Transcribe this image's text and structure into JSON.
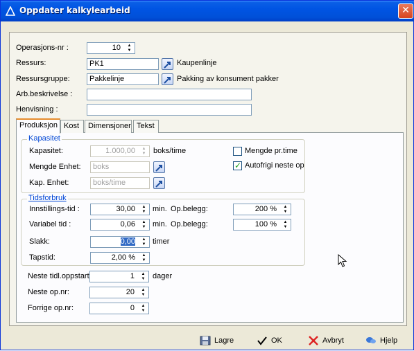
{
  "window": {
    "title": "Oppdater kalkylearbeid",
    "close_symbol": "✕"
  },
  "header_fields": {
    "operasjons_nr": {
      "label": "Operasjons-nr :",
      "value": "10"
    },
    "ressurs": {
      "label": "Ressurs:",
      "value": "PK1",
      "description": "Kaupenlinje"
    },
    "ressursgruppe": {
      "label": "Ressursgruppe:",
      "value": "Pakkelinje",
      "description": "Pakking av konsument pakker"
    },
    "arb_beskrivelse": {
      "label": "Arb.beskrivelse :",
      "value": ""
    },
    "henvisning": {
      "label": "Henvisning :",
      "value": ""
    }
  },
  "tabs": [
    {
      "label": "Produksjon",
      "active": true
    },
    {
      "label": "Kost",
      "active": false
    },
    {
      "label": "Dimensjoner",
      "active": false
    },
    {
      "label": "Tekst",
      "active": false
    }
  ],
  "kapasitet": {
    "group_title": "Kapasitet",
    "kapasitet": {
      "label": "Kapasitet:",
      "value": "1.000,00",
      "unit": "boks/time"
    },
    "mengde_enhet": {
      "label": "Mengde Enhet:",
      "value": "boks"
    },
    "kap_enhet": {
      "label": "Kap. Enhet:",
      "value": "boks/time"
    },
    "mengde_pr_time": {
      "label": "Mengde pr.time",
      "checked": false
    },
    "autofrigi": {
      "label": "Autofrigi neste op",
      "checked": true
    }
  },
  "tidsforbruk": {
    "group_title": "Tidsforbruk",
    "innstillings_tid": {
      "label": "Innstillings-tid :",
      "value": "30,00",
      "unit": "min.",
      "op_label": "Op.belegg:",
      "op_value": "200 %"
    },
    "variabel_tid": {
      "label": "Variabel tid :",
      "value": "0,06",
      "unit": "min.",
      "op_label": "Op.belegg:",
      "op_value": "100 %"
    },
    "slakk": {
      "label": "Slakk:",
      "value": "0,00",
      "unit": "timer"
    },
    "tapstid": {
      "label": "Tapstid:",
      "value": "2,00 %"
    }
  },
  "sequence": {
    "neste_tidl_oppstart": {
      "label": "Neste tidl.oppstart:",
      "value": "1",
      "unit": "dager"
    },
    "neste_op_nr": {
      "label": "Neste op.nr:",
      "value": "20"
    },
    "forrige_op_nr": {
      "label": "Forrige op.nr:",
      "value": "0"
    }
  },
  "buttons": {
    "lagre": "Lagre",
    "ok": "OK",
    "avbryt": "Avbryt",
    "hjelp": "Hjelp"
  },
  "colors": {
    "title_blue": "#0054e3",
    "group_title": "#0046d5",
    "close_red": "#d8441e"
  }
}
